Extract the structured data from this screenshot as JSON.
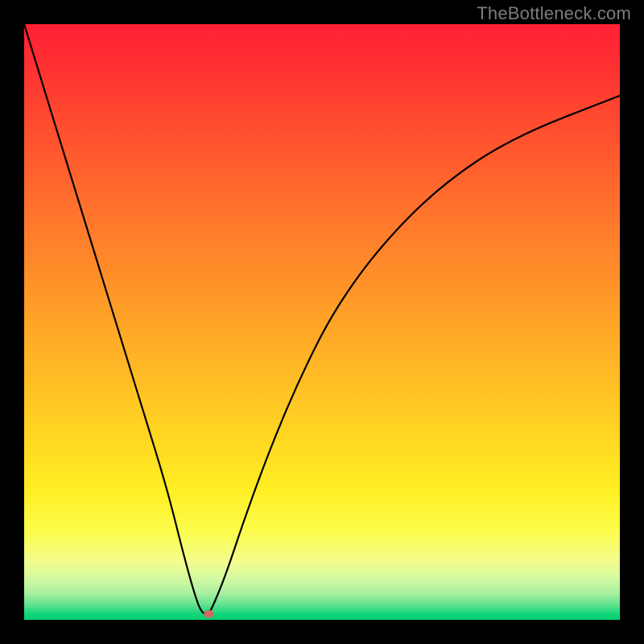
{
  "watermark": "TheBottleneck.com",
  "chart_data": {
    "type": "line",
    "title": "",
    "xlabel": "",
    "ylabel": "",
    "xlim": [
      0,
      100
    ],
    "ylim": [
      0,
      100
    ],
    "grid": false,
    "series": [
      {
        "name": "curve",
        "color": "#000000",
        "x": [
          0,
          4,
          8,
          12,
          16,
          20,
          24,
          27,
          29,
          30,
          31,
          32,
          34,
          37,
          41,
          46,
          52,
          60,
          70,
          82,
          100
        ],
        "y": [
          100,
          87,
          74,
          61,
          48,
          35,
          22,
          10,
          3,
          1,
          1,
          3,
          8,
          17,
          28,
          40,
          52,
          63,
          73,
          81,
          88
        ]
      }
    ],
    "marker": {
      "x": 31,
      "y": 1,
      "color": "#d46a5f",
      "rx": 6,
      "ry": 5
    }
  }
}
